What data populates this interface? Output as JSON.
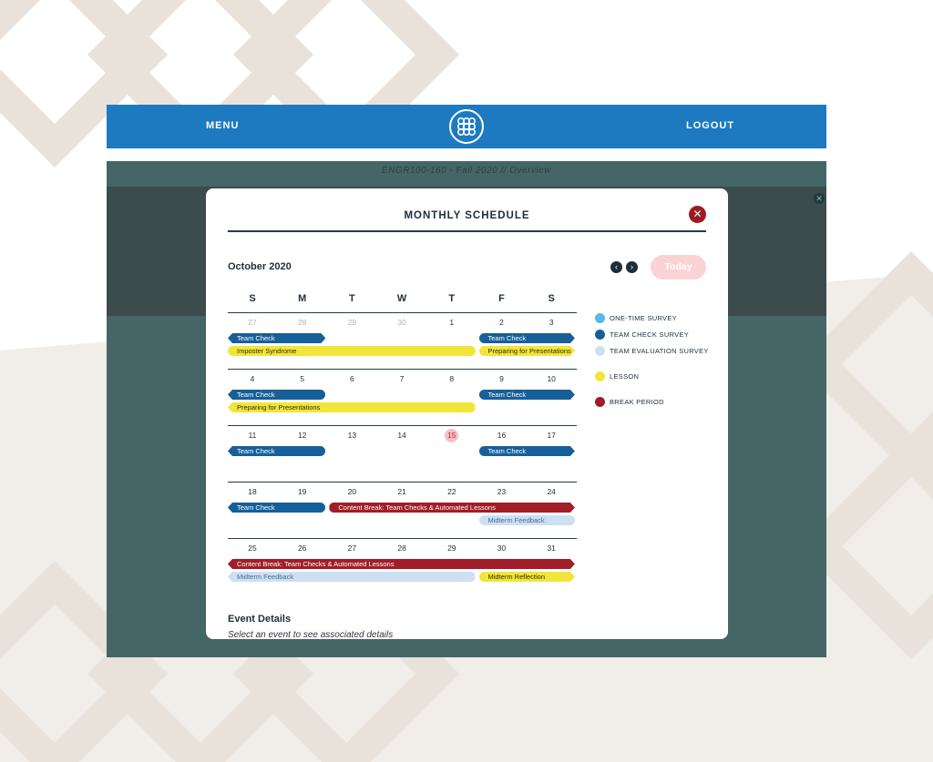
{
  "header": {
    "menu_label": "MENU",
    "logout_label": "LOGOUT",
    "logo_icon": "linked-rings-logo-icon"
  },
  "course_title": "ENGR100-160 - Fall 2020 // Overview",
  "modal": {
    "title": "MONTHLY SCHEDULE",
    "close_icon": "close-icon",
    "month_label": "October 2020",
    "today_label": "Today",
    "prev_icon": "chevron-left-icon",
    "next_icon": "chevron-right-icon"
  },
  "calendar": {
    "weekdays": [
      "S",
      "M",
      "T",
      "W",
      "T",
      "F",
      "S"
    ],
    "weeks": [
      {
        "days": [
          {
            "num": "27",
            "muted": true
          },
          {
            "num": "28",
            "muted": true
          },
          {
            "num": "29",
            "muted": true
          },
          {
            "num": "30",
            "muted": true
          },
          {
            "num": "1"
          },
          {
            "num": "2"
          },
          {
            "num": "3"
          }
        ],
        "events": [
          {
            "label": "Team Check",
            "type": "team_check",
            "start": 0,
            "end": 1,
            "row": 0,
            "cont_left": true,
            "cont_right": true
          },
          {
            "label": "Team Check",
            "type": "team_check",
            "start": 5,
            "end": 6,
            "row": 0,
            "cont_right": true
          },
          {
            "label": "Imposter Syndrome",
            "type": "lesson",
            "start": 0,
            "end": 4,
            "row": 1
          },
          {
            "label": "Preparing for Presentations",
            "type": "lesson",
            "start": 5,
            "end": 6,
            "row": 1,
            "cont_right": true
          }
        ]
      },
      {
        "days": [
          {
            "num": "4"
          },
          {
            "num": "5"
          },
          {
            "num": "6"
          },
          {
            "num": "7"
          },
          {
            "num": "8"
          },
          {
            "num": "9"
          },
          {
            "num": "10"
          }
        ],
        "events": [
          {
            "label": "Team Check",
            "type": "team_check",
            "start": 0,
            "end": 1,
            "row": 0,
            "cont_left": true
          },
          {
            "label": "Team Check",
            "type": "team_check",
            "start": 5,
            "end": 6,
            "row": 0,
            "cont_right": true
          },
          {
            "label": "Preparing for Presentations",
            "type": "lesson",
            "start": 0,
            "end": 4,
            "row": 1,
            "cont_left": true
          }
        ]
      },
      {
        "days": [
          {
            "num": "11"
          },
          {
            "num": "12"
          },
          {
            "num": "13"
          },
          {
            "num": "14"
          },
          {
            "num": "15",
            "today": true
          },
          {
            "num": "16"
          },
          {
            "num": "17"
          }
        ],
        "events": [
          {
            "label": "Team Check",
            "type": "team_check",
            "start": 0,
            "end": 1,
            "row": 0,
            "cont_left": true
          },
          {
            "label": "Team Check",
            "type": "team_check",
            "start": 5,
            "end": 6,
            "row": 0,
            "cont_right": true
          }
        ]
      },
      {
        "days": [
          {
            "num": "18"
          },
          {
            "num": "19"
          },
          {
            "num": "20"
          },
          {
            "num": "21"
          },
          {
            "num": "22"
          },
          {
            "num": "23"
          },
          {
            "num": "24"
          }
        ],
        "events": [
          {
            "label": "Team Check",
            "type": "team_check",
            "start": 0,
            "end": 1,
            "row": 0,
            "cont_left": true
          },
          {
            "label": "Content Break: Team Checks & Automated Lessons",
            "type": "break",
            "start": 2,
            "end": 6,
            "row": 0,
            "cont_right": true
          },
          {
            "label": "Midterm Feedback",
            "type": "team_eval",
            "start": 5,
            "end": 6,
            "row": 1
          }
        ]
      },
      {
        "days": [
          {
            "num": "25"
          },
          {
            "num": "26"
          },
          {
            "num": "27"
          },
          {
            "num": "28"
          },
          {
            "num": "29"
          },
          {
            "num": "30"
          },
          {
            "num": "31"
          }
        ],
        "events": [
          {
            "label": "Content Break: Team Checks & Automated Lessons",
            "type": "break",
            "start": 0,
            "end": 6,
            "row": 0,
            "cont_left": true,
            "cont_right": true
          },
          {
            "label": "Midterm Feedback",
            "type": "team_eval",
            "start": 0,
            "end": 4,
            "row": 1,
            "cont_left": true
          },
          {
            "label": "Midterm Reflection",
            "type": "lesson",
            "start": 5,
            "end": 6,
            "row": 1,
            "cont_right": true
          }
        ]
      }
    ]
  },
  "legend": [
    {
      "label": "ONE-TIME SURVEY",
      "color": "#5cb7ea"
    },
    {
      "label": "TEAM CHECK SURVEY",
      "color": "#175f99"
    },
    {
      "label": "TEAM EVALUATION SURVEY",
      "color": "#cde0f2"
    },
    {
      "label": "LESSON",
      "color": "#f2e53a"
    },
    {
      "label": "BREAK PERIOD",
      "color": "#a11d27"
    }
  ],
  "details": {
    "title": "Event Details",
    "placeholder": "Select an event to see associated details"
  },
  "colors": {
    "topbar": "#1d7ac0",
    "team_check": "#175f99",
    "lesson": "#f2e53a",
    "break": "#a11d27",
    "team_eval": "#cde0f2",
    "today_highlight": "#f6c0c2"
  }
}
